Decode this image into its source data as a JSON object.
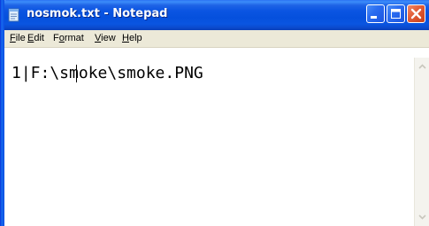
{
  "window": {
    "title": "nosmok.txt - Notepad",
    "app_icon": "notepad-icon",
    "controls": {
      "minimize": "minimize-icon",
      "maximize": "maximize-icon",
      "close": "close-icon"
    }
  },
  "menubar": {
    "file": {
      "accel": "F",
      "rest": "ile"
    },
    "edit": {
      "accel": "E",
      "rest": "dit"
    },
    "format": {
      "pre": "F",
      "accel": "o",
      "rest": "rmat"
    },
    "view": {
      "accel": "V",
      "rest": "iew"
    },
    "help": {
      "accel": "H",
      "rest": "elp"
    }
  },
  "editor": {
    "content": "1|F:\\smoke\\smoke.PNG"
  },
  "scrollbar": {
    "up": "scroll-up-arrow-icon",
    "down": "scroll-down-arrow-icon"
  },
  "colors": {
    "titlebar": "#0550dd",
    "menubar": "#ece9d8",
    "close_button": "#e15b35"
  }
}
